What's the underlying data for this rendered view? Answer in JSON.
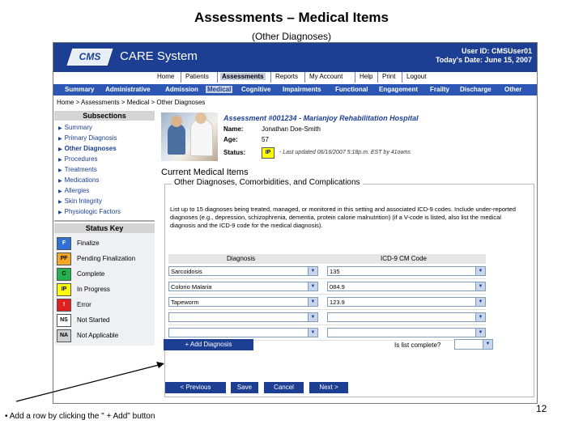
{
  "slide": {
    "title": "Assessments – Medical Items",
    "subtitle": "(Other Diagnoses)",
    "caption": "• Add a row by clicking the \" + Add\" button",
    "page_number": "12"
  },
  "app": {
    "logo": "CMS",
    "name": "CARE System",
    "user_line": "User ID: CMSUser01",
    "date_line": "Today's Date: June 15, 2007"
  },
  "topnav": [
    "Home",
    "Patients",
    "Assessments",
    "Reports",
    "My Account",
    "Help",
    "Print",
    "Logout"
  ],
  "tabs": [
    "Summary",
    "Administrative",
    "Admission",
    "Medical",
    "Cognitive",
    "Impairments",
    "Functional",
    "Engagement",
    "Frailty",
    "Discharge",
    "Other"
  ],
  "breadcrumb": "Home > Assessments > Medical > Other Diagnoses",
  "sidebar": {
    "subsections_label": "Subsections",
    "items": [
      "Summary",
      "Primary Diagnosis",
      "Other Diagnoses",
      "Procedures",
      "Treatments",
      "Medications",
      "Allergies",
      "Skin Integrity",
      "Physiologic Factors"
    ],
    "status_key_label": "Status Key",
    "status_items": [
      {
        "code": "F",
        "label": "Finalize",
        "color": "#2f6fd8",
        "text_color": "#ffffff"
      },
      {
        "code": "PF",
        "label": "Pending Finalization",
        "color": "#f5a623",
        "text_color": "#000000"
      },
      {
        "code": "C",
        "label": "Complete",
        "color": "#22b14c",
        "text_color": "#000000"
      },
      {
        "code": "IP",
        "label": "In Progress",
        "color": "#ffff00",
        "text_color": "#000000"
      },
      {
        "code": "!",
        "label": "Error",
        "color": "#e02020",
        "text_color": "#ffffff"
      },
      {
        "code": "NS",
        "label": "Not Started",
        "color": "#ffffff",
        "text_color": "#000000"
      },
      {
        "code": "NA",
        "label": "Not Applicable",
        "color": "#cfcfcf",
        "text_color": "#000000"
      }
    ]
  },
  "patient": {
    "assessment_title": "Assessment #001234 - Marianjoy Rehabilitation Hospital",
    "name_label": "Name:",
    "name_value": "Jonathan Doe-Smith",
    "age_label": "Age:",
    "age_value": "57",
    "status_label": "Status:",
    "status_code": "IP",
    "last_updated": "- Last updated 06/16/2007 5:18p.m. EST by 41owns"
  },
  "section": {
    "title": "Current Medical Items",
    "legend": "Other Diagnoses, Comorbidities, and Complications",
    "description": "List up to 15 diagnoses being treated, managed, or monitored in this setting and associated ICD-9 codes. Include under-reported diagnoses (e.g., depression, schizophrenia, dementia, protein calorie malnutrition) (if a V-code is listed, also list the medical diagnosis and the ICD-9 code for the medical diagnosis)."
  },
  "grid": {
    "col_diagnosis": "Diagnosis",
    "col_icd": "ICD-9 CM Code",
    "rows": [
      {
        "diagnosis": "Sarcoidosis",
        "icd": "135"
      },
      {
        "diagnosis": "Colorio Malaria",
        "icd": "084.9"
      },
      {
        "diagnosis": "Tapeworm",
        "icd": "123.9"
      },
      {
        "diagnosis": "",
        "icd": ""
      },
      {
        "diagnosis": "",
        "icd": ""
      }
    ]
  },
  "actions": {
    "add_diagnosis": "+ Add Diagnosis",
    "list_complete_label": "Is list complete?",
    "list_complete_value": "",
    "previous": "< Previous",
    "save": "Save",
    "cancel": "Cancel",
    "next": "Next >"
  },
  "colors": {
    "banner": "#1c3f93",
    "tab_bar": "#2b56b4",
    "active_tab_bg": "#c6cfe0"
  }
}
